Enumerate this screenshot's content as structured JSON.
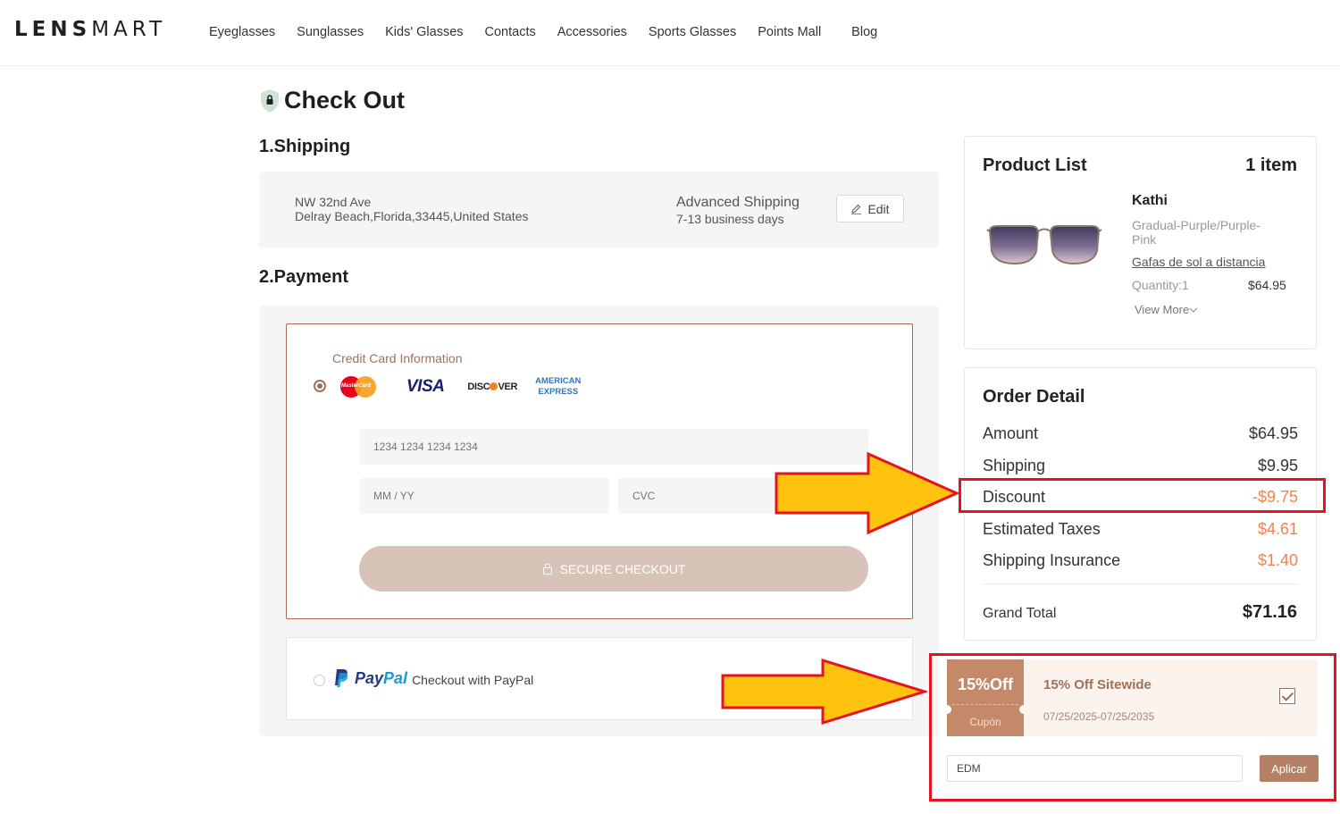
{
  "nav": {
    "logo_bold": "LENS",
    "logo_thin": "MART",
    "items": [
      "Eyeglasses",
      "Sunglasses",
      "Kids' Glasses",
      "Contacts",
      "Accessories",
      "Sports Glasses",
      "Points Mall",
      "Blog"
    ]
  },
  "page": {
    "title": "Check Out",
    "shipping_heading": "1.Shipping",
    "payment_heading": "2.Payment"
  },
  "shipping": {
    "address_line1": "NW 32nd Ave",
    "address_line2": "Delray Beach,Florida,33445,United States",
    "method": "Advanced Shipping",
    "days": "7-13 business days",
    "edit_label": "Edit"
  },
  "payment": {
    "card_info_label": "Credit Card Information",
    "card_logos": {
      "mastercard": "MasterCard",
      "visa": "VISA",
      "discover_pre": "DISC",
      "discover_post": "VER",
      "amex_line1": "AMERICAN",
      "amex_line2": "EXPRESS"
    },
    "card_number_placeholder": "1234 1234 1234 1234",
    "expiry_placeholder": "MM / YY",
    "cvc_placeholder": "CVC",
    "secure_checkout_label": "SECURE CHECKOUT",
    "paypal_logo_a": "Pay",
    "paypal_logo_b": "Pal",
    "paypal_label": "Checkout with PayPal",
    "selected_method": "credit-card"
  },
  "product_list": {
    "title": "Product List",
    "count": "1 item",
    "product": {
      "name": "Kathi",
      "color": "Gradual-Purple/Purple-Pink",
      "category": "Gafas de sol a distancia",
      "quantity": "Quantity:1",
      "price": "$64.95",
      "view_more": "View More"
    }
  },
  "order_detail": {
    "title": "Order Detail",
    "rows": [
      {
        "label": "Amount",
        "value": "$64.95"
      },
      {
        "label": "Shipping",
        "value": "$9.95"
      },
      {
        "label": "Discount",
        "value": "-$9.75"
      },
      {
        "label": "Estimated Taxes",
        "value": "$4.61"
      },
      {
        "label": "Shipping Insurance",
        "value": "$1.40"
      }
    ],
    "grand_total_label": "Grand Total",
    "grand_total_value": "$71.16"
  },
  "coupon": {
    "stub_main": "15%Off",
    "stub_sub": "Cupón",
    "title": "15% Off Sitewide",
    "date_range": "07/25/2025-07/25/2035",
    "checked": true,
    "code_value": "EDM",
    "apply_label": "Aplicar"
  },
  "colors": {
    "brand_brown": "#a0705a",
    "accent_orange": "#f0834a",
    "highlight_red": "#e5131f",
    "arrow_yellow": "#ffc20e"
  }
}
